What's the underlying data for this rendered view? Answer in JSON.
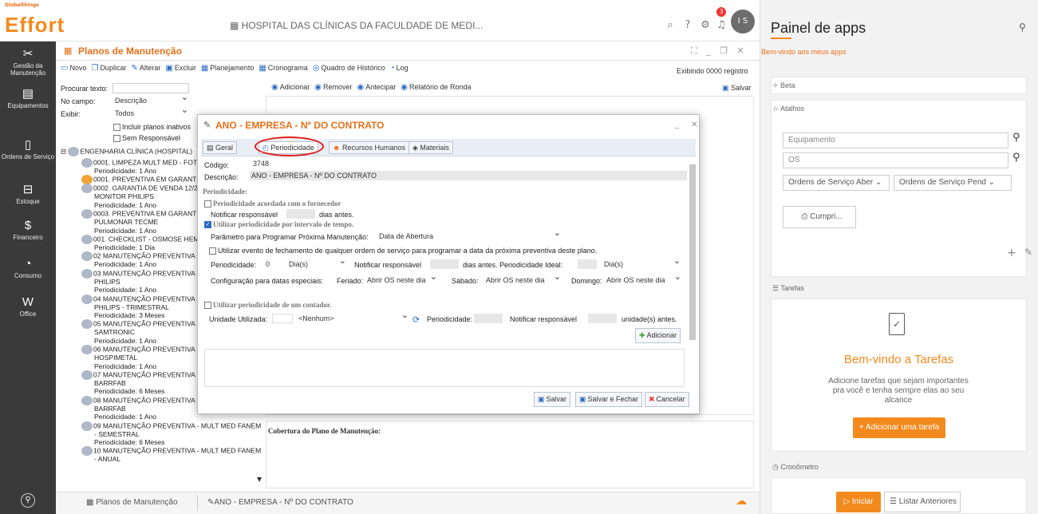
{
  "app": {
    "logo_small": "Globalthings",
    "logo": "Effort",
    "hospital": "HOSPITAL DAS CLÍNICAS DA FACULDADE DE MEDI...",
    "avatar": "I S",
    "notif_count": "3"
  },
  "nav": [
    {
      "label": "Gestão da Manutenção",
      "icon": "wrench-icon",
      "glyph": "✂"
    },
    {
      "label": "Equipamentos",
      "icon": "equipment-icon",
      "glyph": "▤"
    },
    {
      "label": "Ordens de Serviço",
      "icon": "work-order-icon",
      "glyph": "▯"
    },
    {
      "label": "Estoque",
      "icon": "stock-icon",
      "glyph": "⊟"
    },
    {
      "label": "Financeiro",
      "icon": "finance-icon",
      "glyph": "$"
    },
    {
      "label": "Consumo",
      "icon": "consumption-icon",
      "glyph": "◔"
    },
    {
      "label": "Office",
      "icon": "office-icon",
      "glyph": "W"
    }
  ],
  "module": {
    "title": "Planos de Manutenção",
    "exibindo": "Exibindo 0000 registro",
    "toolbar": [
      "Novo",
      "Duplicar",
      "Alterar",
      "Excluir",
      "Planejamento",
      "Cronograma",
      "Quadro de Histórico",
      "Log"
    ]
  },
  "filters": {
    "search_label": "Procurar texto:",
    "field_label": "No campo:",
    "field_value": "Descrição",
    "show_label": "Exibir:",
    "show_value": "Todos",
    "inactive": "Incluir planos inativos",
    "no_resp": "Sem Responsável"
  },
  "tree": {
    "root": "ENGENHARIA CLÍNICA (HOSPITAL)",
    "nodes": [
      "0001. LIMPEZA MULT MED - FOT",
      "Periodicidade: 1 Ano",
      "0001. PREVENTIVA EM GARANTI",
      "0002. GARANTIA DE VENDA 12/2",
      "MONITOR PHILIPS",
      "Periodicidade: 1 Ano",
      "0003. PREVENTIVA EM GARANTI",
      "PULMONAR TECME",
      "Periodicidade: 1 Ano",
      "001. CHECKLIST - OSMOSE HEM",
      "Periodicidade: 1 Dia",
      "02 MANUTENÇÃO PREVENTIVA -",
      "Periodicidade: 1 Ano",
      "03 MANUTENÇÃO PREVENTIVA -",
      "PHILIPS",
      "Periodicidade: 1 Ano",
      "04 MANUTENÇÃO PREVENTIVA -",
      "PHILIPS - TRIMESTRAL",
      "Periodicidade: 3 Meses",
      "05 MANUTENÇÃO PREVENTIVA -",
      "SAMTRONIC",
      "Periodicidade: 1 Ano",
      "06 MANUTENÇÃO PREVENTIVA -",
      "HOSPIMETAL",
      "Periodicidade: 1 Ano",
      "07 MANUTENÇÃO PREVENTIVA -",
      "BARRFAB",
      "Periodicidade: 6 Meses",
      "08 MANUTENÇÃO PREVENTIVA - MULT MED",
      "BARRFAB",
      "Periodicidade: 1 Ano",
      "09 MANUTENÇÃO PREVENTIVA - MULT MED FANEM",
      "- SEMESTRAL",
      "Periodicidade: 6 Meses",
      "10 MANUTENÇÃO PREVENTIVA - MULT MED FANEM",
      "- ANUAL"
    ]
  },
  "right_toolbar": [
    "Adicionar",
    "Remover",
    "Antecipar",
    "Relatório de Ronda"
  ],
  "salvar": "Salvar",
  "cobertura": "Cobertura do Plano de Manutenção:",
  "dialog": {
    "title": "ANO - EMPRESA - Nº DO CONTRATO",
    "tabs": [
      "Geral",
      "Periodicidade",
      "Recursos Humanos",
      "Materiais"
    ],
    "codigo_label": "Código:",
    "codigo": "3748",
    "descricao_label": "Descrição:",
    "descricao": "ANO - EMPRESA - Nº DO CONTRATO",
    "section": "Periodicidade:",
    "acordada": "Periodicidade acordada com o fornecedor",
    "notificar_resp": "Notificar responsável",
    "dias_antes": "dias antes.",
    "intervalo": "Utilizar periodicidade por intervalo de tempo.",
    "parametro_label": "Parâmetro para Programar Próxima Manutenção:",
    "parametro": "Data de Abertura",
    "evento": "Utilizar evento de fechamento de qualquer ordem de serviço para programar a data da próxima preventiva deste plano.",
    "periodicidade_label": "Periodicidade:",
    "periodicidade_val": "0",
    "periodo_unit": "Dia(s)",
    "notificar_label": "Notificar responsável",
    "dias_ideal": "dias antes. Periodicidade Ideal:",
    "ideal_unit": "Dia(s)",
    "config_label": "Configuração para datas especiais:",
    "feriado_label": "Feriado:",
    "feriado": "Abrir OS neste dia",
    "sabado_label": "Sábado:",
    "sabado": "Abrir OS neste dia",
    "domingo_label": "Domingo:",
    "domingo": "Abrir OS neste dia",
    "contador": "Utilizar periodicidade de um contador.",
    "unidade_label": "Unidade Utilizada:",
    "unidade": "<Nenhum>",
    "periodicidade2": "Periodicidade:",
    "notificar2": "Notificar responsável",
    "unidades_antes": "unidade(s) antes.",
    "adicionar": "Adicionar",
    "buttons": [
      "Salvar",
      "Salvar e Fechar",
      "Cancelar"
    ]
  },
  "bottom": {
    "tab1": "Planos de Manutenção",
    "tab2": "ANO - EMPRESA - Nº DO CONTRATO"
  },
  "panel": {
    "title": "Painel de apps",
    "welcome": "Bem-vindo aos meus apps",
    "beta": "Beta",
    "atalhos": "Atalhos",
    "equip_ph": "Equipamento",
    "os_ph": "OS",
    "sel1": "Ordens de Serviço Aber",
    "sel2": "Ordens de Serviço Pend",
    "cumpri": "Cumpri...",
    "tarefas": "Tarefas",
    "tarefas_title": "Bem-vindo a Tarefas",
    "tarefas_desc": "Adicione tarefas que sejam importantes pra você e tenha sempre elas ao seu alcance",
    "add_task": "+ Adicionar uma tarefa",
    "cronometro": "Cronômetro",
    "iniciar": "Iniciar",
    "listar": "Listar Anteriores"
  },
  "colors": {
    "accent": "#f28a1d",
    "nav_bg": "#3a3a3a",
    "highlight": "#e01b1b"
  }
}
